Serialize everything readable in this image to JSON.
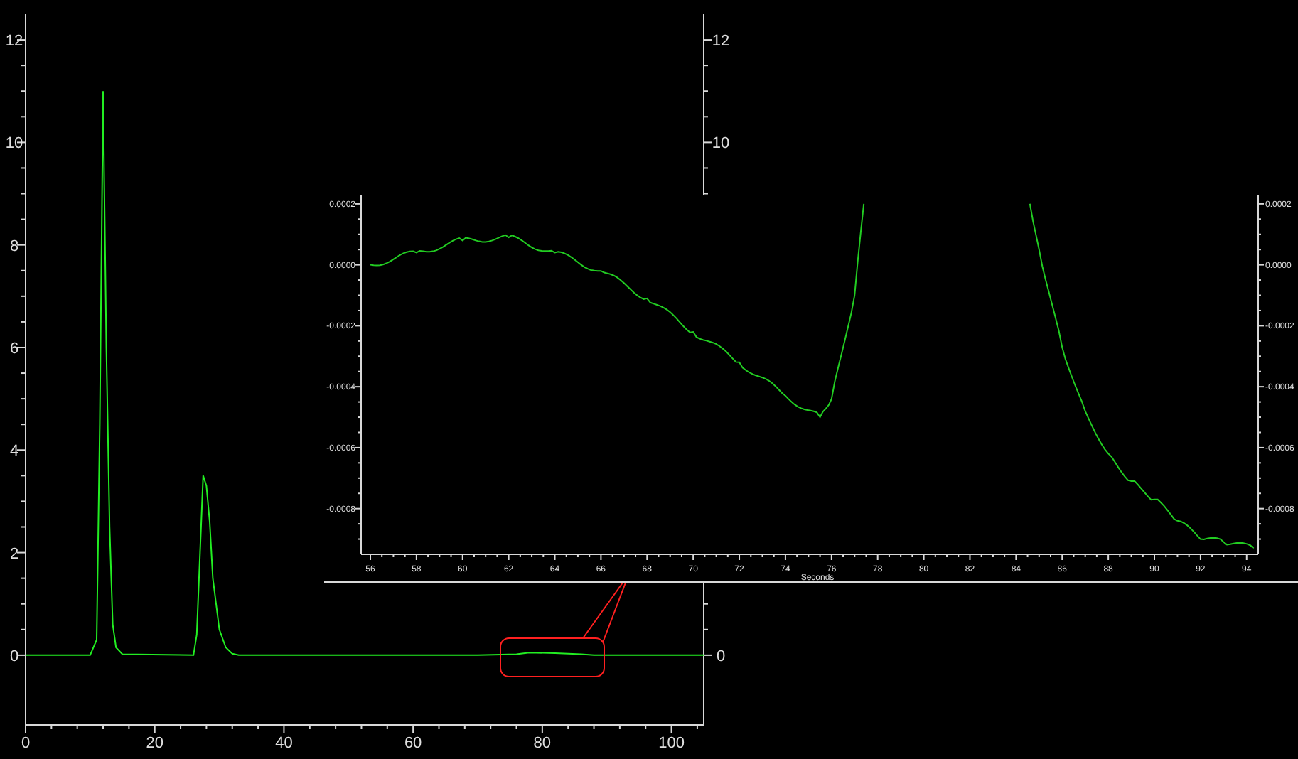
{
  "main_chart": {
    "chart_data": {
      "type": "line",
      "xlim": [
        0,
        105
      ],
      "ylim": [
        -1.36,
        12.5
      ],
      "xticks": [
        0,
        20,
        40,
        60,
        80,
        100
      ],
      "yticks": [
        0,
        2,
        4,
        6,
        8,
        10,
        12
      ],
      "x": [
        0,
        10,
        11,
        11.5,
        12,
        12.5,
        13,
        13.5,
        14,
        15,
        26,
        26.5,
        27,
        27.5,
        28,
        28.5,
        29,
        30,
        31,
        32,
        33,
        70,
        76,
        78,
        82,
        86,
        88,
        105
      ],
      "series": [
        {
          "color": "#22ee22",
          "values": [
            0,
            0,
            0.3,
            4.5,
            11,
            6,
            2.5,
            0.6,
            0.15,
            0.02,
            0,
            0.4,
            2,
            3.5,
            3.3,
            2.6,
            1.5,
            0.5,
            0.15,
            0.03,
            0,
            0,
            0.02,
            0.05,
            0.04,
            0.02,
            0,
            0
          ]
        }
      ]
    },
    "right_axis_labels": [
      "12",
      "10",
      "0"
    ]
  },
  "inset_chart": {
    "chart_data": {
      "type": "line",
      "xlabel": "Seconds",
      "xlim": [
        55.6,
        94.5
      ],
      "ylim": [
        -0.00095,
        0.00023
      ],
      "xticks": [
        56,
        58,
        60,
        62,
        64,
        66,
        68,
        70,
        72,
        74,
        76,
        78,
        80,
        82,
        84,
        86,
        88,
        90,
        92,
        94
      ],
      "yticks": [
        {
          "value": 0.0002,
          "label": "0.0002"
        },
        {
          "value": 0,
          "label": "0.0000"
        },
        {
          "value": -0.0002,
          "label": "-0.0002"
        },
        {
          "value": -0.0004,
          "label": "-0.0004"
        },
        {
          "value": -0.0006,
          "label": "-0.0006"
        },
        {
          "value": -0.0008,
          "label": "-0.0008"
        }
      ],
      "x": [
        56,
        58,
        60,
        62,
        64,
        66,
        68,
        70,
        72,
        74,
        75.5,
        76,
        77,
        77.4,
        81,
        84.6,
        85,
        86,
        87,
        88,
        89,
        90,
        91,
        92,
        93,
        94.3
      ],
      "series": [
        {
          "color": "#22cc22",
          "values": [
            0,
            4e-05,
            8e-05,
            9e-05,
            4e-05,
            -2e-05,
            -0.00011,
            -0.00022,
            -0.00032,
            -0.00043,
            -0.0005,
            -0.00044,
            -0.0001,
            0.0002,
            null,
            0.0002,
            5e-05,
            -0.00027,
            -0.00048,
            -0.00062,
            -0.00071,
            -0.00077,
            -0.00084,
            -0.0009,
            -0.00091,
            -0.00093
          ]
        }
      ]
    },
    "right_axis_labels": [
      "0.0002",
      "0.0000",
      "-0.0002",
      "-0.0004",
      "-0.0006",
      "-0.0008"
    ]
  }
}
